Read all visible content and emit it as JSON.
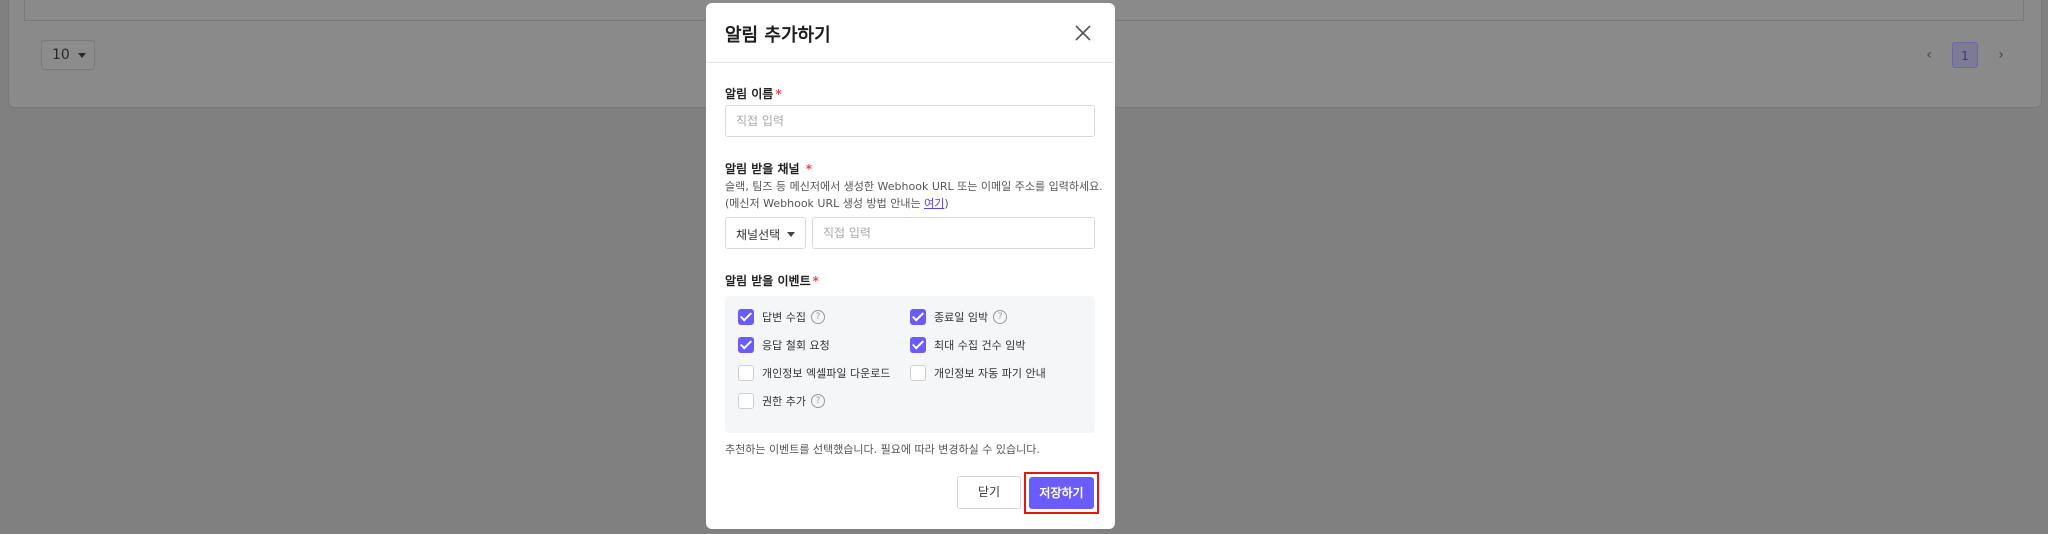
{
  "background": {
    "page_size": "10",
    "pagination": {
      "prev": "‹",
      "current": "1",
      "next": "›"
    }
  },
  "modal": {
    "title": "알림 추가하기",
    "close_icon": "close-icon",
    "name_field": {
      "label": "알림 이름",
      "required": "*",
      "placeholder": "직접 입력",
      "value": ""
    },
    "channel_field": {
      "label": "알림 받을 채널",
      "required": "*",
      "help_line1": "슬랙, 팀즈 등 메신저에서 생성한 Webhook URL 또는 이메일 주소를 입력하세요.",
      "help_line2_prefix": "(메신저 Webhook URL 생성 방법 안내는 ",
      "help_link": "여기",
      "help_line2_suffix": ")",
      "select_value": "채널선택",
      "input_placeholder": "직접 입력"
    },
    "events": {
      "label": "알림 받을 이벤트",
      "required": "*",
      "items": [
        {
          "label": "답변 수집",
          "checked": true,
          "help_icon": true
        },
        {
          "label": "종료일 임박",
          "checked": true,
          "help_icon": true
        },
        {
          "label": "응답 철회 요청",
          "checked": true,
          "help_icon": false
        },
        {
          "label": "최대 수집 건수 임박",
          "checked": true,
          "help_icon": false
        },
        {
          "label": "개인정보 엑셀파일 다운로드",
          "checked": false,
          "help_icon": false
        },
        {
          "label": "개인정보 자동 파기 안내",
          "checked": false,
          "help_icon": false
        },
        {
          "label": "권한 추가",
          "checked": false,
          "help_icon": true
        }
      ],
      "note": "추천하는 이벤트를 선택했습니다. 필요에 따라 변경하실 수 있습니다."
    },
    "buttons": {
      "close": "닫기",
      "save": "저장하기"
    },
    "colors": {
      "accent": "#6a5cff",
      "required": "#e5484d",
      "highlight": "#e01818"
    }
  }
}
